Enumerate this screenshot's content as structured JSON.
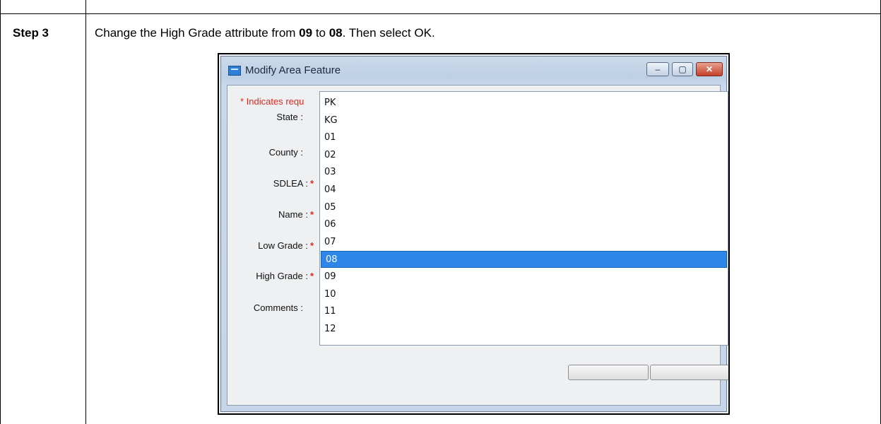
{
  "step": {
    "label": "Step 3",
    "instruction_pre": "Change the High Grade attribute from ",
    "from_value": "09",
    "instruction_mid": " to ",
    "to_value": "08",
    "instruction_post": ". Then select OK."
  },
  "dialog": {
    "title": "Modify Area Feature",
    "required_note": "* Indicates requ",
    "fields": [
      {
        "label": "State :",
        "required": false
      },
      {
        "label": "County :",
        "required": false
      },
      {
        "label": "SDLEA :",
        "required": true
      },
      {
        "label": "Name :",
        "required": true
      },
      {
        "label": "Low Grade :",
        "required": true
      },
      {
        "label": "High Grade :",
        "required": true
      },
      {
        "label": "Comments :",
        "required": false
      }
    ],
    "required_marker": "*"
  },
  "dropdown": {
    "options": [
      "PK",
      "KG",
      "01",
      "02",
      "03",
      "04",
      "05",
      "06",
      "07",
      "08",
      "09",
      "10",
      "11",
      "12"
    ],
    "selected": "08"
  },
  "colors": {
    "required": "#e0281f",
    "selection": "#2d86e8"
  },
  "icons": {
    "app": "app-icon",
    "minimize": "minimize-icon",
    "maximize": "maximize-icon",
    "close": "close-icon"
  }
}
